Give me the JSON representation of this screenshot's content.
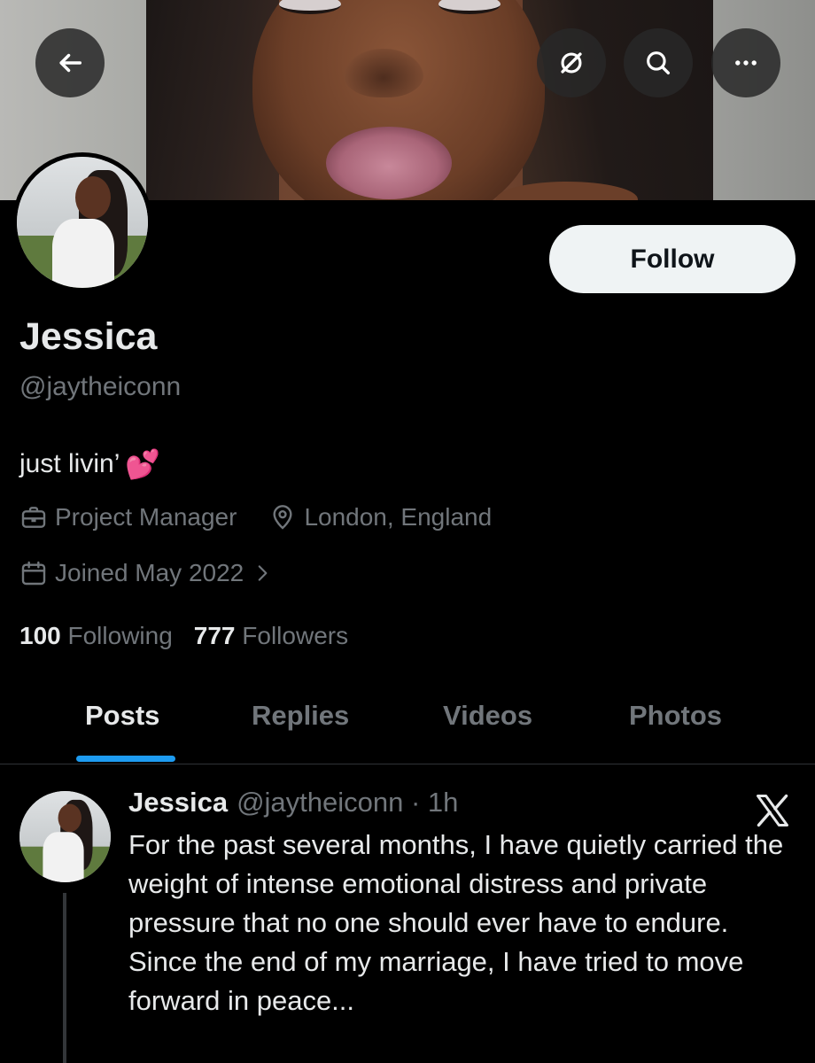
{
  "header": {
    "back_icon": "arrow-left-icon",
    "grok_icon": "grok-icon",
    "search_icon": "search-icon",
    "more_icon": "more-icon"
  },
  "profile": {
    "name": "Jessica",
    "handle": "@jaytheiconn",
    "bio": "just livin’",
    "bio_emoji": "💕",
    "profession": "Project Manager",
    "location": "London, England",
    "joined": "Joined May 2022",
    "follow_label": "Follow",
    "following_count": "100",
    "following_label": "Following",
    "followers_count": "777",
    "followers_label": "Followers"
  },
  "tabs": [
    {
      "label": "Posts",
      "active": true
    },
    {
      "label": "Replies",
      "active": false
    },
    {
      "label": "Videos",
      "active": false
    },
    {
      "label": "Photos",
      "active": false
    }
  ],
  "post": {
    "name": "Jessica",
    "meta": "@jaytheiconn · 1h",
    "lines": [
      "For the past several months, I have quietly carried the weight of intense emotional distress and private pressure that no one should ever have to endure.",
      "Since the end of my marriage, I have tried to move forward in peace..."
    ]
  },
  "colors": {
    "background": "#000000",
    "text_primary": "#e7e9ea",
    "text_secondary": "#71767b",
    "accent": "#1d9bf0",
    "follow_bg": "#eff3f4"
  }
}
